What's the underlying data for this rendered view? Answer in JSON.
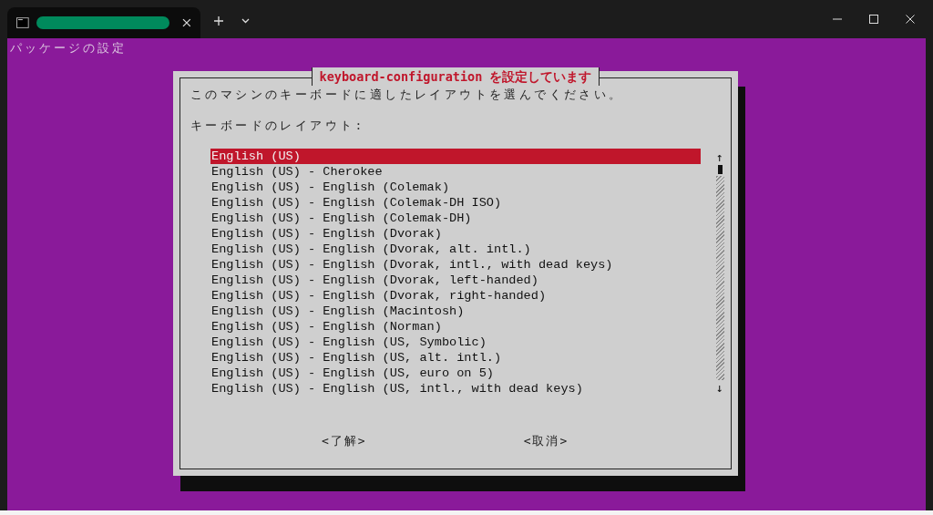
{
  "terminal": {
    "header": "パッケージの設定"
  },
  "dialog": {
    "title": "keyboard-configuration を設定しています",
    "prompt": "このマシンのキーボードに適したレイアウトを選んでください。",
    "label": "キーボードのレイアウト:",
    "items": [
      {
        "label": "English (US)",
        "selected": true
      },
      {
        "label": "English (US) - Cherokee",
        "selected": false
      },
      {
        "label": "English (US) - English (Colemak)",
        "selected": false
      },
      {
        "label": "English (US) - English (Colemak-DH ISO)",
        "selected": false
      },
      {
        "label": "English (US) - English (Colemak-DH)",
        "selected": false
      },
      {
        "label": "English (US) - English (Dvorak)",
        "selected": false
      },
      {
        "label": "English (US) - English (Dvorak, alt. intl.)",
        "selected": false
      },
      {
        "label": "English (US) - English (Dvorak, intl., with dead keys)",
        "selected": false
      },
      {
        "label": "English (US) - English (Dvorak, left-handed)",
        "selected": false
      },
      {
        "label": "English (US) - English (Dvorak, right-handed)",
        "selected": false
      },
      {
        "label": "English (US) - English (Macintosh)",
        "selected": false
      },
      {
        "label": "English (US) - English (Norman)",
        "selected": false
      },
      {
        "label": "English (US) - English (US, Symbolic)",
        "selected": false
      },
      {
        "label": "English (US) - English (US, alt. intl.)",
        "selected": false
      },
      {
        "label": "English (US) - English (US, euro on 5)",
        "selected": false
      },
      {
        "label": "English (US) - English (US, intl., with dead keys)",
        "selected": false
      }
    ],
    "scroll_up": "↑",
    "scroll_down": "↓",
    "buttons": [
      "<了解>",
      "<取消>"
    ]
  }
}
